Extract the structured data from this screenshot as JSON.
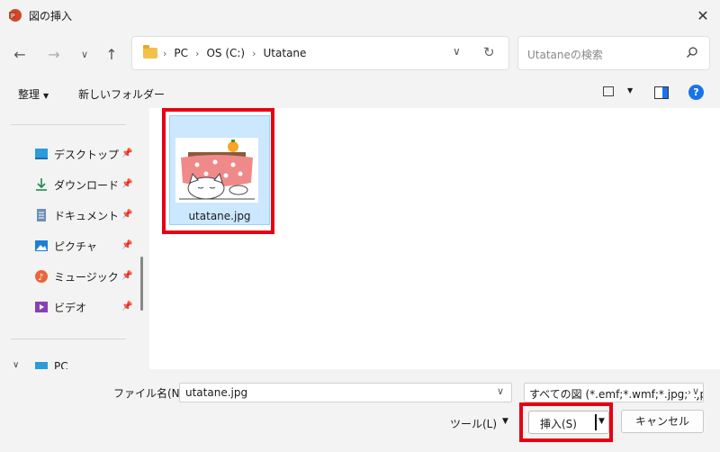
{
  "window": {
    "title": "図の挿入"
  },
  "nav": {
    "breadcrumbs": [
      "PC",
      "OS (C:)",
      "Utatane"
    ]
  },
  "search": {
    "placeholder": "Utataneの検索"
  },
  "toolbar": {
    "organize": "整理",
    "new_folder": "新しいフォルダー"
  },
  "sidebar": {
    "items": [
      {
        "label": "デスクトップ",
        "icon": "desktop-icon"
      },
      {
        "label": "ダウンロード",
        "icon": "download-icon"
      },
      {
        "label": "ドキュメント",
        "icon": "document-icon"
      },
      {
        "label": "ピクチャ",
        "icon": "pictures-icon"
      },
      {
        "label": "ミュージック",
        "icon": "music-icon"
      },
      {
        "label": "ビデオ",
        "icon": "video-icon"
      }
    ],
    "pc_label": "PC"
  },
  "files": [
    {
      "name": "utatane.jpg",
      "selected": true
    }
  ],
  "bottom": {
    "filename_label": "ファイル名(N):",
    "filename_value": "utatane.jpg",
    "filter": "すべての図 (*.emf;*.wmf;*.jpg;*.jp",
    "tools": "ツール(L)",
    "insert": "挿入(S)",
    "cancel": "キャンセル"
  },
  "colors": {
    "highlight": "#e60012",
    "selection": "#cce8ff",
    "help": "#1a73e8"
  }
}
